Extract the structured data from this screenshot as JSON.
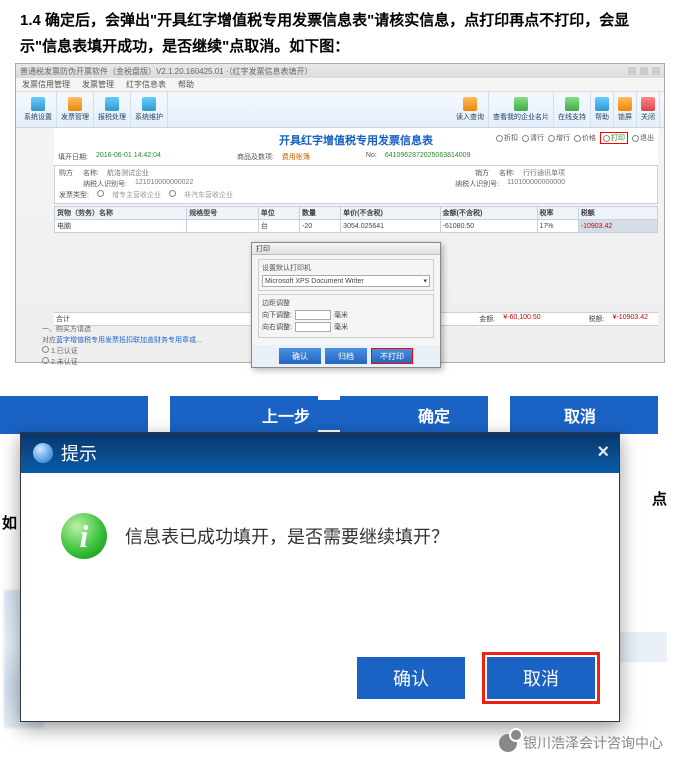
{
  "instruction": "1.4 确定后，会弹出\"开具红字增值税专用发票信息表\"请核实信息，点打印再点不打印，会显示\"信息表填开成功，是否继续\"点取消。如下图：",
  "app": {
    "title": "普通税发票防伪开票软件（金税盘版）V2.1.20.160425.01 ·（红字发票信息表填开）",
    "menu": [
      "发票信用管理",
      "发票管理",
      "红字信息表",
      "帮助"
    ],
    "toolbar": {
      "left": [
        {
          "label": "系统设置",
          "iconClass": "i-blue"
        },
        {
          "label": "发票管理",
          "iconClass": "i-orange"
        },
        {
          "label": "报税处理",
          "iconClass": "i-blue"
        },
        {
          "label": "系统维护",
          "iconClass": "i-blue"
        }
      ],
      "right": [
        {
          "label": "读入查询",
          "iconClass": "i-orange"
        },
        {
          "label": "查看我的企业名片",
          "iconClass": "i-green"
        },
        {
          "label": "在线支持",
          "iconClass": "i-green"
        },
        {
          "label": "帮助",
          "iconClass": "i-blue"
        },
        {
          "label": "锁屏",
          "iconClass": "i-orange"
        },
        {
          "label": "关闭",
          "iconClass": "i-red"
        }
      ]
    }
  },
  "form": {
    "title": "开具红字增值税专用发票信息表",
    "right_opts": [
      "折扣",
      "清行",
      "增行",
      "价格",
      "打印",
      "退出"
    ],
    "fill_date_label": "填开日期:",
    "fill_date": "2016-06-01 14:42:04",
    "qty_label": "商品及数项:",
    "qty_val": "费用账簿",
    "no_label": "No:",
    "no_val": "6410962872025063814009",
    "buyer_label": "购方",
    "seller_label": "销方",
    "name_label": "名称:",
    "tax_id_label": "纳税人识别号:",
    "buyer_name": "航洛测试企业",
    "buyer_tax_id": "121010000000022",
    "seller_name": "行行通讯单项",
    "seller_tax_id": "110100000000000",
    "invoice_type_label": "发票类型:",
    "invoice_type": "增专主营收企业",
    "invoice_type2": "非汽车营收企业"
  },
  "table": {
    "headers": [
      "货物（劳务）名称",
      "规格型号",
      "单位",
      "数量",
      "单价(不含税)",
      "金额(不含税)",
      "税率",
      "税额"
    ],
    "rows": [
      [
        "电脑",
        "",
        "台",
        "-20",
        "3054.025641",
        "-61080.50",
        "17%",
        "-10903.42"
      ]
    ]
  },
  "totals": {
    "hj_label": "合计",
    "amount_label": "金额:",
    "amount": "¥-60,100.50",
    "tax_label": "税额:",
    "tax": "¥-10903.42"
  },
  "bottom_left": {
    "line1": "一、购买方请选",
    "line2_prefix": "对应",
    "line2_link": "蓝字增值税专用发票抵扣联加盖财务专用章或...",
    "opt1": "1.已认证",
    "opt2": "2.未认证"
  },
  "print_dialog": {
    "title": "打印",
    "group1_label": "设置默认打印机",
    "select_val": "Microsoft XPS Document Writer",
    "group2_label": "边距调整",
    "margin_v_label": "向下调整:",
    "margin_h_label": "向右调整:",
    "unit": "毫米",
    "btns": [
      "确认",
      "归档",
      "不打印"
    ]
  },
  "background_buttons": [
    "上一步",
    "确定",
    "取消"
  ],
  "confirm_dialog": {
    "title": "提示",
    "message": "信息表已成功填开，是否需要继续填开？",
    "ok": "确认",
    "cancel": "取消"
  },
  "side_text_right": "点",
  "side_text_left": "如",
  "watermark": "银川浩泽会计咨询中心"
}
